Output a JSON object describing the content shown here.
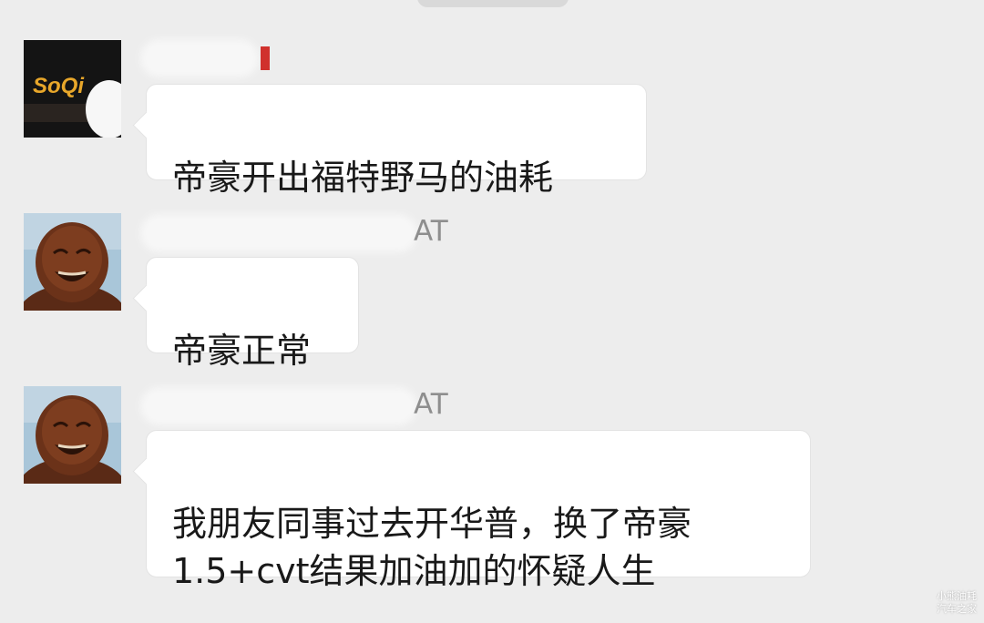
{
  "messages": [
    {
      "sender_suffix": "",
      "text": "帝豪开出福特野马的油耗",
      "avatar": "soqi-logo-avatar"
    },
    {
      "sender_suffix": "AT",
      "text": "帝豪正常",
      "avatar": "laughing-buddha-avatar"
    },
    {
      "sender_suffix": "AT",
      "text": "我朋友同事过去开华普，换了帝豪\n1.5+cvt结果加油加的怀疑人生",
      "avatar": "laughing-buddha-avatar"
    }
  ],
  "avatar_logo_text": "SoQi",
  "watermark": {
    "line1": "小熊油耗",
    "line2": "汽车之家"
  },
  "colors": {
    "background": "#ededed",
    "bubble": "#ffffff",
    "sender_text": "#8e8e8e",
    "message_text": "#191919"
  }
}
